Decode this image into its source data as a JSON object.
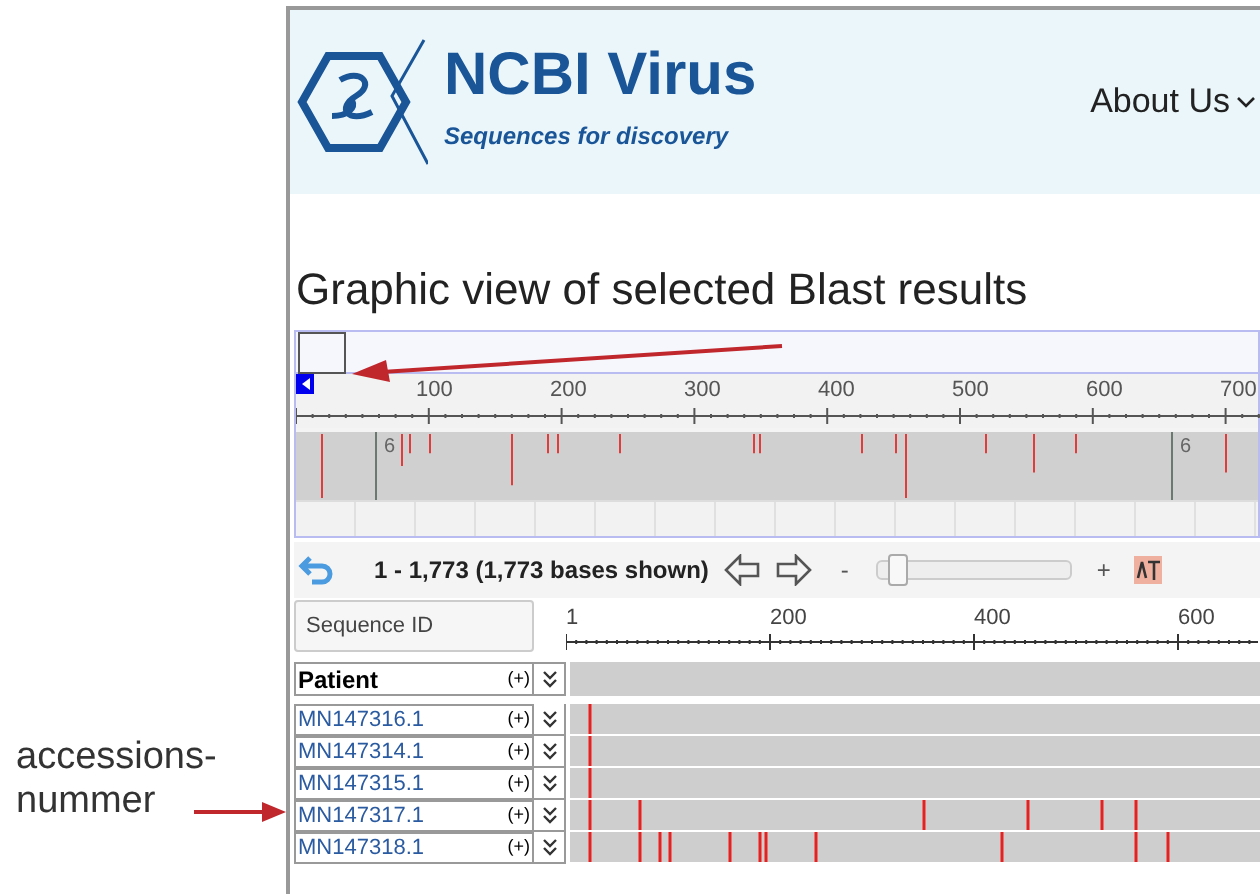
{
  "annotation": {
    "lines": [
      "accessions-",
      "nummer"
    ]
  },
  "header": {
    "logo_title": "NCBI Virus",
    "tagline": "Sequences for discovery",
    "nav": "About Us"
  },
  "page_title": "Graphic view of selected Blast results",
  "overview": {
    "ticks": [
      "100",
      "200",
      "300",
      "400",
      "500",
      "600",
      "700"
    ],
    "marker_labels": [
      "6",
      "6"
    ]
  },
  "toolbar": {
    "range": "1 - 1,773 (1,773 bases shown)",
    "zoom_out": "-",
    "zoom_in": "+",
    "level": 0.05
  },
  "sequence_header": {
    "button": "Sequence ID",
    "ticks": [
      "1",
      "200",
      "400",
      "600"
    ]
  },
  "group": {
    "label": "Patient",
    "expand": "(+)"
  },
  "rows": [
    {
      "id": "MN147316.1",
      "expand": "(+)"
    },
    {
      "id": "MN147314.1",
      "expand": "(+)"
    },
    {
      "id": "MN147315.1",
      "expand": "(+)"
    },
    {
      "id": "MN147317.1",
      "expand": "(+)"
    },
    {
      "id": "MN147318.1",
      "expand": "(+)"
    }
  ]
}
